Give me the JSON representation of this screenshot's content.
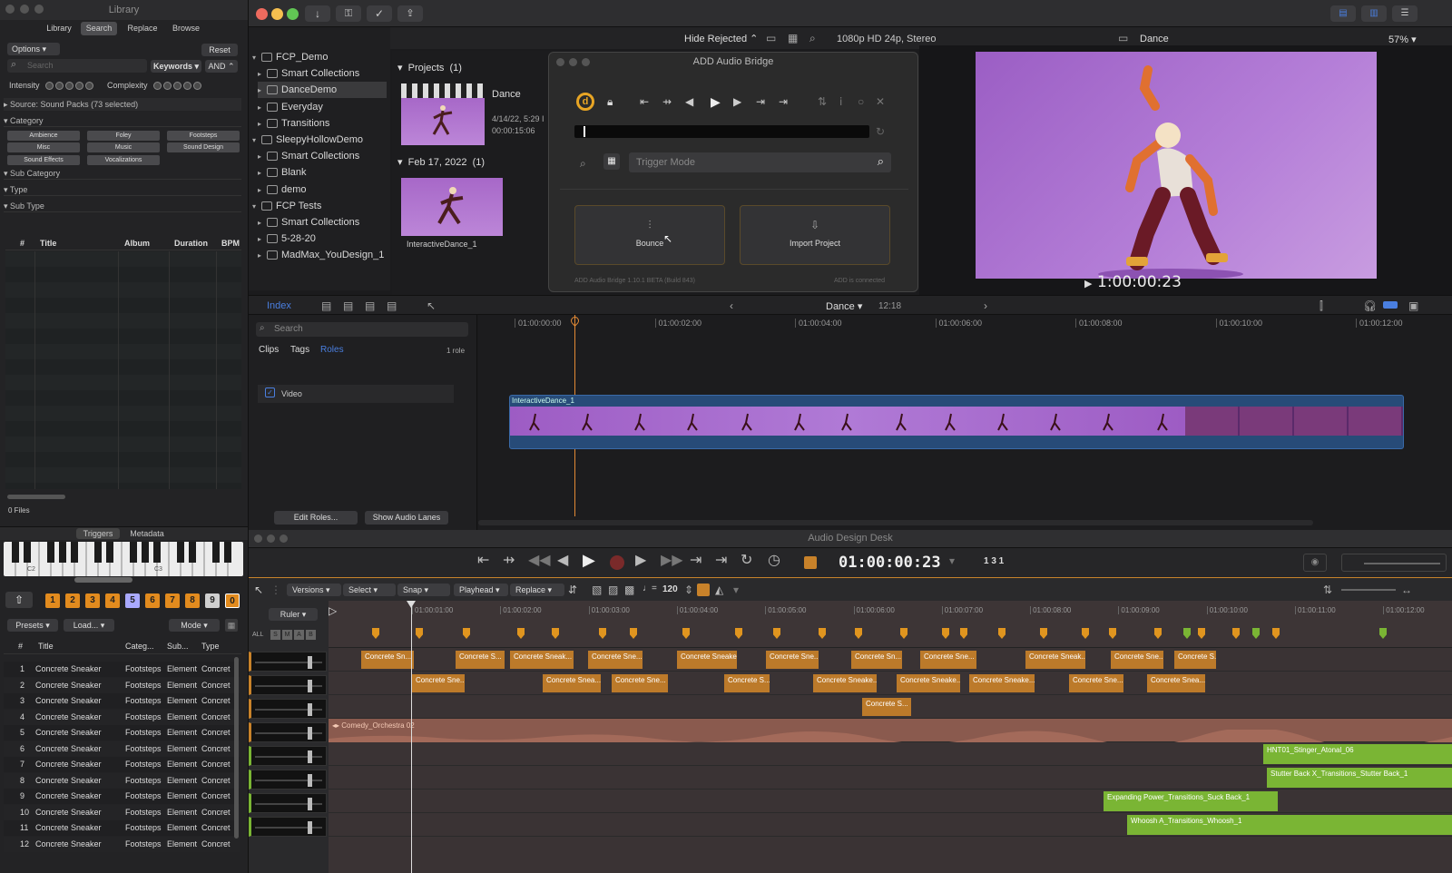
{
  "library": {
    "title": "Library",
    "tabs": [
      "Library",
      "Search",
      "Replace",
      "Browse"
    ],
    "options_label": "Options",
    "reset_label": "Reset",
    "search_placeholder": "Search",
    "keywords_label": "Keywords",
    "and_label": "AND",
    "intensity_label": "Intensity",
    "complexity_label": "Complexity",
    "source_label": "Source: Sound Packs (73 selected)",
    "category_label": "Category",
    "categories": [
      "Ambience",
      "Foley",
      "Footsteps",
      "Misc",
      "Music",
      "Sound Design",
      "Sound Effects",
      "Vocalizations"
    ],
    "sub_category_label": "Sub Category",
    "type_label": "Type",
    "sub_type_label": "Sub Type",
    "table_headers": [
      "#",
      "Title",
      "Album",
      "Duration",
      "BPM"
    ],
    "files_count": "0 Files",
    "bottom_tabs": [
      "Triggers",
      "Metadata"
    ],
    "piano_labels": [
      "C2",
      "C3"
    ],
    "number_keys": [
      "1",
      "2",
      "3",
      "4",
      "5",
      "6",
      "7",
      "8",
      "9",
      "0"
    ],
    "presets_label": "Presets",
    "load_label": "Load...",
    "mode_label": "Mode",
    "trigger_headers": [
      "#",
      "Title",
      "Categ...",
      "Sub...",
      "Type"
    ],
    "trigger_rows": [
      {
        "n": "1",
        "title": "Concrete Sneaker",
        "cat": "Footsteps",
        "sub": "Element",
        "type": "Concret"
      },
      {
        "n": "2",
        "title": "Concrete Sneaker",
        "cat": "Footsteps",
        "sub": "Element",
        "type": "Concret"
      },
      {
        "n": "3",
        "title": "Concrete Sneaker",
        "cat": "Footsteps",
        "sub": "Element",
        "type": "Concret"
      },
      {
        "n": "4",
        "title": "Concrete Sneaker",
        "cat": "Footsteps",
        "sub": "Element",
        "type": "Concret"
      },
      {
        "n": "5",
        "title": "Concrete Sneaker",
        "cat": "Footsteps",
        "sub": "Element",
        "type": "Concret"
      },
      {
        "n": "6",
        "title": "Concrete Sneaker",
        "cat": "Footsteps",
        "sub": "Element",
        "type": "Concret"
      },
      {
        "n": "7",
        "title": "Concrete Sneaker",
        "cat": "Footsteps",
        "sub": "Element",
        "type": "Concret"
      },
      {
        "n": "8",
        "title": "Concrete Sneaker",
        "cat": "Footsteps",
        "sub": "Element",
        "type": "Concret"
      },
      {
        "n": "9",
        "title": "Concrete Sneaker",
        "cat": "Footsteps",
        "sub": "Element",
        "type": "Concret"
      },
      {
        "n": "10",
        "title": "Concrete Sneaker",
        "cat": "Footsteps",
        "sub": "Element",
        "type": "Concret"
      },
      {
        "n": "11",
        "title": "Concrete Sneaker",
        "cat": "Footsteps",
        "sub": "Element",
        "type": "Concret"
      },
      {
        "n": "12",
        "title": "Concrete Sneaker",
        "cat": "Footsteps",
        "sub": "Element",
        "type": "Concret"
      }
    ]
  },
  "fcp": {
    "hide_rejected": "Hide Rejected",
    "format": "1080p HD 24p, Stereo",
    "project_name": "Dance",
    "zoom": "57%",
    "browser_items": [
      {
        "label": "FCP_Demo",
        "level": 0,
        "kind": "library"
      },
      {
        "label": "Smart Collections",
        "level": 1,
        "kind": "folder"
      },
      {
        "label": "DanceDemo",
        "level": 1,
        "kind": "event"
      },
      {
        "label": "Everyday",
        "level": 1,
        "kind": "event"
      },
      {
        "label": "Transitions",
        "level": 1,
        "kind": "event"
      },
      {
        "label": "SleepyHollowDemo",
        "level": 0,
        "kind": "library"
      },
      {
        "label": "Smart Collections",
        "level": 1,
        "kind": "folder"
      },
      {
        "label": "Blank",
        "level": 1,
        "kind": "event"
      },
      {
        "label": "demo",
        "level": 1,
        "kind": "event"
      },
      {
        "label": "FCP Tests",
        "level": 0,
        "kind": "library"
      },
      {
        "label": "Smart Collections",
        "level": 1,
        "kind": "folder"
      },
      {
        "label": "5-28-20",
        "level": 1,
        "kind": "event"
      },
      {
        "label": "MadMax_YouDesign_1",
        "level": 1,
        "kind": "event"
      }
    ],
    "projects_header": "Projects",
    "projects_count": "(1)",
    "project_title": "Dance",
    "project_date": "4/14/22, 5:29 I",
    "project_duration": "00:00:15:06",
    "date_group": "Feb 17, 2022",
    "date_group_count": "(1)",
    "clip_name": "InteractiveDance_1",
    "viewer_timecode": "1:00:00:23",
    "index_label": "Index",
    "timeline_project": "Dance",
    "timeline_duration": "12:18",
    "ruler": [
      "01:00:00:00",
      "01:00:02:00",
      "01:00:04:00",
      "01:00:06:00",
      "01:00:08:00",
      "01:00:10:00",
      "01:00:12:00"
    ],
    "timeline_search_placeholder": "Search",
    "index_tabs": [
      "Clips",
      "Tags",
      "Roles"
    ],
    "role_count": "1 role",
    "role_video": "Video",
    "edit_roles": "Edit Roles...",
    "show_audio_lanes": "Show Audio Lanes",
    "timeline_clip_name": "InteractiveDance_1"
  },
  "bridge": {
    "title": "ADD Audio Bridge",
    "trigger_placeholder": "Trigger Mode",
    "bounce_label": "Bounce",
    "import_label": "Import Project",
    "footer_left": "ADD Audio Bridge 1.10.1 BETA (Build 843)",
    "footer_right": "ADD is connected"
  },
  "desk": {
    "title": "Audio Design Desk",
    "timecode": "01:00:00:23",
    "bars": "1 3 1",
    "toolbar": [
      "Versions",
      "Select",
      "Snap",
      "Playhead",
      "Replace"
    ],
    "tempo": "120",
    "ruler_label": "Ruler",
    "all_label": "ALL",
    "smab": [
      "S",
      "M",
      "A",
      "B"
    ],
    "ruler": [
      "01:00:01:00",
      "01:00:02:00",
      "01:00:03:00",
      "01:00:04:00",
      "01:00:05:00",
      "01:00:06:00",
      "01:00:07:00",
      "01:00:08:00",
      "01:00:09:00",
      "01:00:10:00",
      "01:00:11:00",
      "01:00:12:00"
    ],
    "lane1_clips": [
      "Concrete Sn...",
      "Concrete S...",
      "Concrete Sneak...",
      "Concrete Sne...",
      "Concrete Sneake...",
      "Concrete Sne...",
      "Concrete Sn...",
      "Concrete Sne...",
      "Concrete Sneak...",
      "Concrete Sne...",
      "Concrete S..."
    ],
    "lane2_clips": [
      "Concrete Sne...",
      "Concrete Snea...",
      "Concrete Sne...",
      "Concrete S...",
      "Concrete Sneake...",
      "Concrete Sneake...",
      "Concrete Sneake...",
      "Concrete Sne...",
      "Concrete Snea..."
    ],
    "lane3_clips": [
      "Concrete S..."
    ],
    "orchestra_clip": "Comedy_Orchestra 02",
    "green_clips": [
      "HNT01_Stinger_Atonal_06",
      "Stutter Back X_Transitions_Stutter Back_1",
      "Expanding Power_Transitions_Suck Back_1",
      "Whoosh A_Transitions_Whoosh_1"
    ]
  },
  "colors": {
    "accent_orange": "#e28b1e",
    "clip_purple": "#a768c8",
    "green_clip": "#7ab534",
    "blue_tab": "#4a7fe0"
  }
}
